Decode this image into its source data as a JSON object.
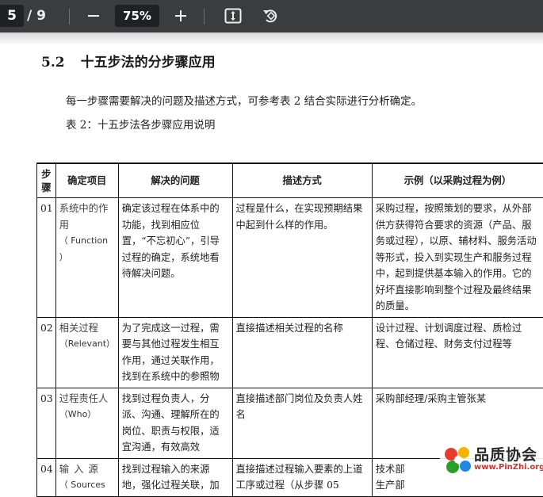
{
  "toolbar": {
    "page_current": "5",
    "page_total": "/ 9",
    "zoom": "75%"
  },
  "doc": {
    "section_number": "5.2",
    "section_title": "十五步法的分步骤应用",
    "paragraph": "每一步骤需要解决的问题及描述方式，可参考表 2 结合实际进行分析确定。",
    "table_caption": "表 2：十五步法各步骤应用说明"
  },
  "table": {
    "headers": [
      "步骤",
      "确定项目",
      "解决的问题",
      "描述方式",
      "示例（以采购过程为例）"
    ],
    "rows": [
      {
        "step": "01",
        "item": "系统中的作用",
        "item_en": "（ Function ）",
        "problem": "确定该过程在体系中的功能，找到相应位置，“不忘初心”，引导过程的确定，系统地看待解决问题。",
        "method": "过程是什么，在实现预期结果中起到什么样的作用。",
        "example": "采购过程，按照策划的要求，从外部供方获得符合要求的资源（产品、服务或过程），以原、辅材料、服务活动等形式，投入到实现生产和服务过程中，起到提供基本输入的作用。它的好坏直接影响到整个过程及最终结果的质量。"
      },
      {
        "step": "02",
        "item": "相关过程",
        "item_en": "（Relevant）",
        "problem": "为了完成这一过程，需要与其他过程发生相互作用，通过关联作用，找到在系统中的参照物",
        "method": "直接描述相关过程的名称",
        "example": "设计过程、计划调度过程、质检过程、仓储过程、财务支付过程等"
      },
      {
        "step": "03",
        "item": "过程责任人",
        "item_en": "（Who）",
        "problem": "找到过程负责人，分派、沟通、理解所在的岗位、职责与权限，适宜沟通，有效高效",
        "method": "直接描述部门岗位及负责人姓名",
        "example": "采购部经理/采购主管张某"
      },
      {
        "step": "04",
        "item": "输入源",
        "item_en": "（ Sources",
        "problem": "找到过程输入的来源地，强化过程关联，加",
        "method": "直接描述过程输入要素的上道工序或过程（从步骤 05",
        "example": "技术部\n生产部"
      }
    ]
  },
  "watermark": {
    "brand": "品质协会",
    "url": "www.PinZhi.org"
  }
}
